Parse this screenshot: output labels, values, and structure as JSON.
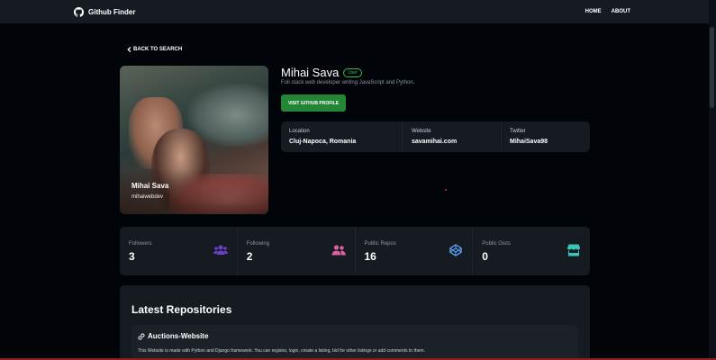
{
  "navbar": {
    "brand": "Github Finder",
    "links": [
      "HOME",
      "ABOUT"
    ]
  },
  "back_label": "BACK TO SEARCH",
  "user": {
    "name": "Mihai Sava",
    "login": "mihaiwebdev",
    "type_badge": "User",
    "bio": "Full stack web developer writing JavaScript and Python.",
    "visit_button": "VISIT GITHUB PROFILE"
  },
  "info": [
    {
      "label": "Location",
      "value": "Cluj-Napoca, Romania"
    },
    {
      "label": "Website",
      "value": "savamihai.com"
    },
    {
      "label": "Twitter",
      "value": "MihaiSava98"
    }
  ],
  "stats": [
    {
      "label": "Followers",
      "value": "3",
      "icon": "users-icon",
      "color": "#6e40c9"
    },
    {
      "label": "Following",
      "value": "2",
      "icon": "user-friends-icon",
      "color": "#db61a2"
    },
    {
      "label": "Public Repos",
      "value": "16",
      "icon": "codepen-icon",
      "color": "#58a6ff"
    },
    {
      "label": "Public Gists",
      "value": "0",
      "icon": "store-icon",
      "color": "#39c5bb"
    }
  ],
  "repos": {
    "title": "Latest Repositories",
    "items": [
      {
        "name": "Auctions-Website",
        "description": "This Website is made with Python and Django framework. You can register, login, create a listing, bid for other listings or add comments to them."
      }
    ]
  },
  "colors": {
    "background": "#010409",
    "card": "#161b22",
    "accent_green": "#238636"
  }
}
